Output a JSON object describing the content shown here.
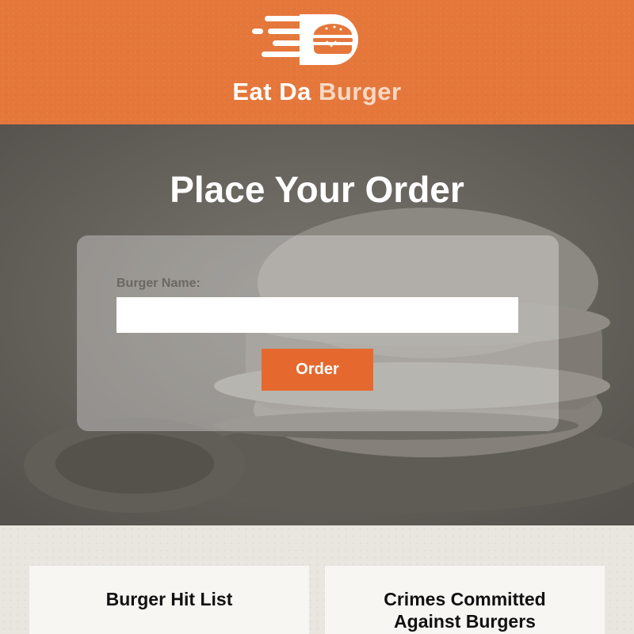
{
  "header": {
    "brand_part1": "Eat Da",
    "brand_part2": "Burger",
    "logo_icon": "flying-burger-icon",
    "color": "#e5773b"
  },
  "hero": {
    "title": "Place Your Order",
    "background_icon": "burger-photo"
  },
  "order_form": {
    "label": "Burger Name:",
    "input_value": "",
    "input_placeholder": "",
    "button_label": "Order",
    "button_color": "#e5692e"
  },
  "lists": {
    "left_title": "Burger Hit List",
    "right_title_line1": "Crimes Committed",
    "right_title_line2": "Against Burgers"
  }
}
